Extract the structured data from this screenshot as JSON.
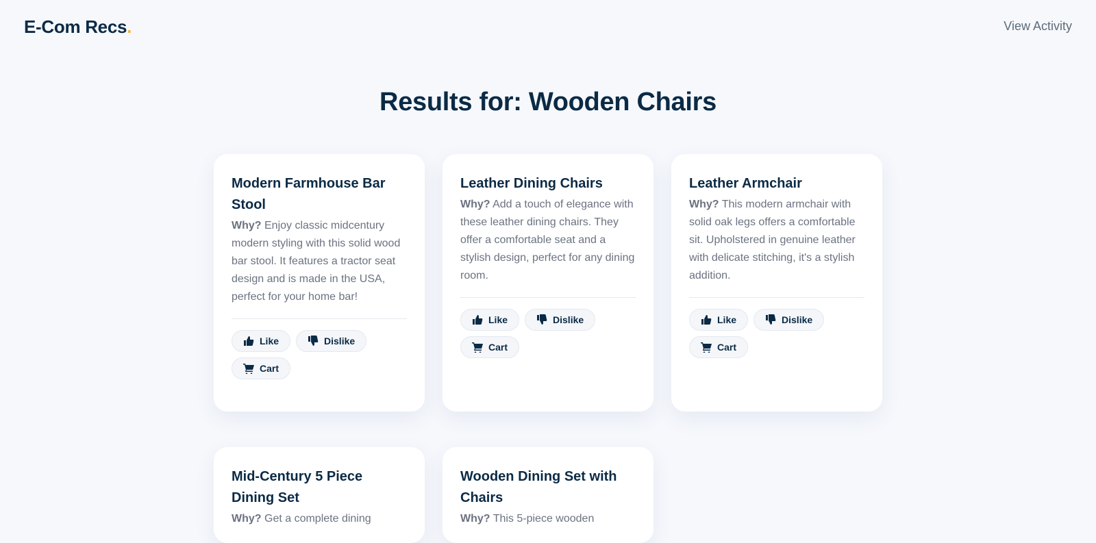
{
  "header": {
    "logo_text": "E-Com Recs",
    "logo_dot": ".",
    "view_activity": "View Activity"
  },
  "page": {
    "title": "Results for: Wooden Chairs"
  },
  "labels": {
    "why": "Why?",
    "like": "Like",
    "dislike": "Dislike",
    "cart": "Cart"
  },
  "products": [
    {
      "title": "Modern Farmhouse Bar Stool",
      "why": "Enjoy classic midcentury modern styling with this solid wood bar stool. It features a tractor seat design and is made in the USA, perfect for your home bar!"
    },
    {
      "title": "Leather Dining Chairs",
      "why": "Add a touch of elegance with these leather dining chairs. They offer a comfortable seat and a stylish design, perfect for any dining room."
    },
    {
      "title": "Leather Armchair",
      "why": "This modern armchair with solid oak legs offers a comfortable sit. Upholstered in genuine leather with delicate stitching, it's a stylish addition."
    },
    {
      "title": "Mid-Century 5 Piece Dining Set",
      "why": "Get a complete dining"
    },
    {
      "title": "Wooden Dining Set with Chairs",
      "why": "This 5-piece wooden"
    }
  ],
  "colors": {
    "background": "#f6f8fc",
    "navy": "#0b2a45",
    "accent_dot": "#f2b632",
    "muted_text": "#6b7280"
  },
  "icons": {
    "like": "thumbs-up-icon",
    "dislike": "thumbs-down-icon",
    "cart": "cart-icon"
  }
}
